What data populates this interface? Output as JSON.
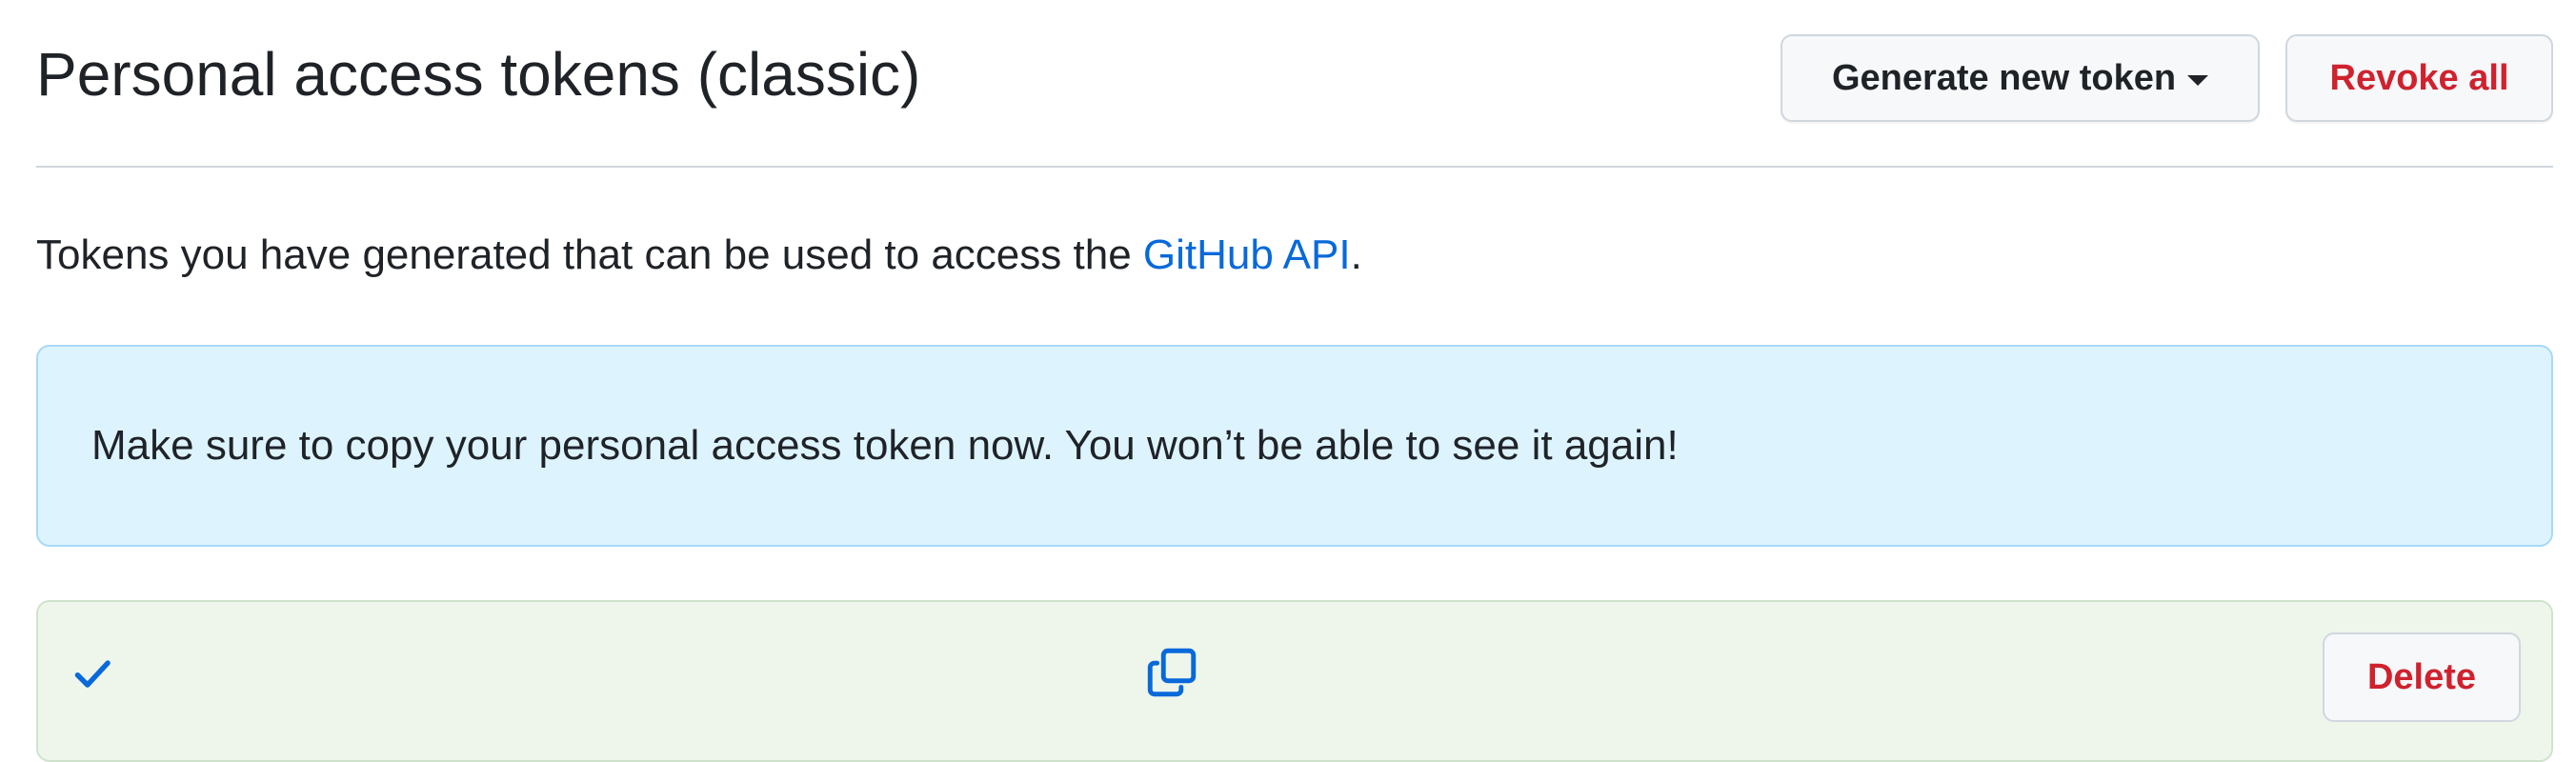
{
  "header": {
    "title": "Personal access tokens (classic)",
    "generate_label": "Generate new token",
    "revoke_label": "Revoke all"
  },
  "intro": {
    "text_before": "Tokens you have generated that can be used to access the ",
    "link_label": "GitHub API",
    "text_after": "."
  },
  "flash": {
    "message": "Make sure to copy your personal access token now. You won’t be able to see it again!"
  },
  "token": {
    "delete_label": "Delete"
  },
  "icons": {
    "check": "check-icon",
    "copy": "copy-icon",
    "caret": "triangle-down-icon"
  },
  "colors": {
    "link": "#0969da",
    "danger": "#cf222e",
    "flash_bg": "#ddf4ff",
    "flash_border": "#a8d8f5",
    "token_bg": "#eef6ec"
  }
}
